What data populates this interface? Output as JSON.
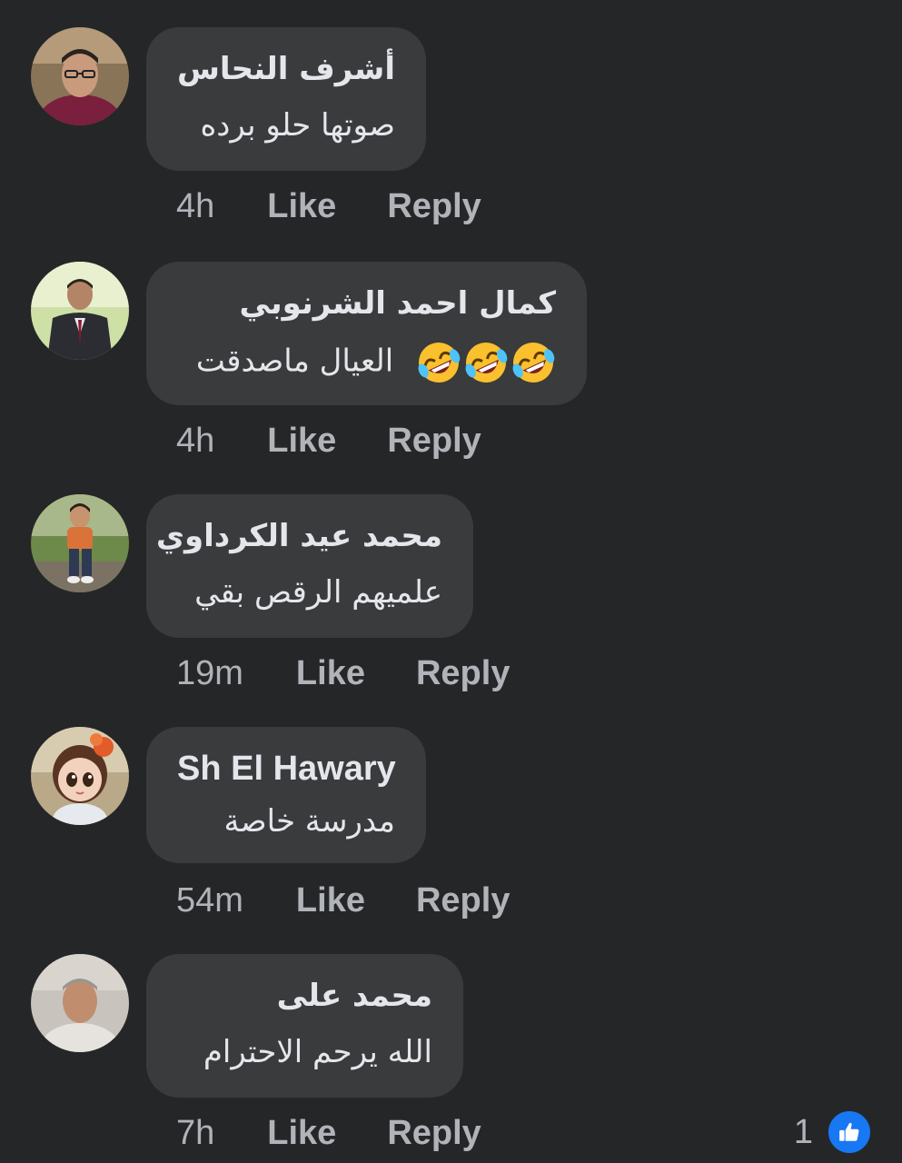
{
  "colors": {
    "background": "#252628",
    "bubble": "#3a3b3d",
    "text_primary": "#e4e6eb",
    "text_secondary": "#b0b3b8",
    "like_blue": "#1877f2"
  },
  "comments": [
    {
      "author": "أشرف النحاس",
      "text": "صوتها حلو برده",
      "time": "4h",
      "like_label": "Like",
      "reply_label": "Reply",
      "avatar_icon": "profile-photo-man-glasses"
    },
    {
      "author": "كمال احمد الشرنوبي",
      "text": "العيال ماصدقت",
      "emojis": [
        "rolling-on-floor-laughing-emoji",
        "rolling-on-floor-laughing-emoji",
        "rolling-on-floor-laughing-emoji"
      ],
      "emoji_chars": "🤣🤣🤣",
      "time": "4h",
      "like_label": "Like",
      "reply_label": "Reply",
      "avatar_icon": "profile-photo-man-suit"
    },
    {
      "author": "محمد عيد الكرداوي",
      "text": "علميهم الرقص بقي",
      "time": "19m",
      "like_label": "Like",
      "reply_label": "Reply",
      "avatar_icon": "profile-photo-child"
    },
    {
      "author": "Sh El Hawary",
      "text": "مدرسة خاصة",
      "time": "54m",
      "like_label": "Like",
      "reply_label": "Reply",
      "avatar_icon": "profile-photo-cartoon-girl"
    },
    {
      "author": "محمد على",
      "text": "الله يرحم الاحترام",
      "time": "7h",
      "like_label": "Like",
      "reply_label": "Reply",
      "avatar_icon": "profile-photo-older-man",
      "reaction_count": "1",
      "reaction_icon": "thumbs-up-icon"
    }
  ]
}
